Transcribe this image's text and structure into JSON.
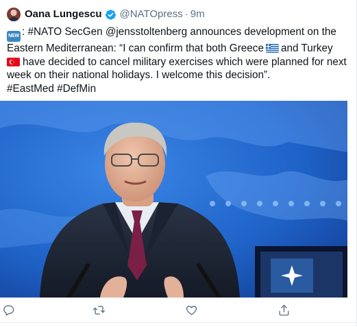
{
  "tweet": {
    "author": {
      "display_name": "Oana Lungescu",
      "verified": true,
      "handle": "@NATOpress",
      "separator": "·",
      "time": "9m"
    },
    "text": {
      "line1_pre": ": #NATO SecGen @jensstoltenberg announces development on the",
      "line2": "Eastern Mediterranean: “I can confirm that both Greece",
      "line2_post": "and Turkey",
      "line3": "have decided to cancel military exercises which were planned for next",
      "line4": "week on their national holidays. I welcome this decision”.",
      "hashtags": "#EastMed #DefMin",
      "new_badge": "NEW"
    },
    "photo": {
      "icon": "photo-nato-secgen-press-conference"
    }
  },
  "actions": {
    "reply_icon": "reply-icon",
    "retweet_icon": "retweet-icon",
    "like_icon": "like-icon",
    "share_icon": "share-icon"
  },
  "colors": {
    "verified": "#1da1f2",
    "muted": "#5b7083",
    "photo_bg": "#1f63c8"
  }
}
